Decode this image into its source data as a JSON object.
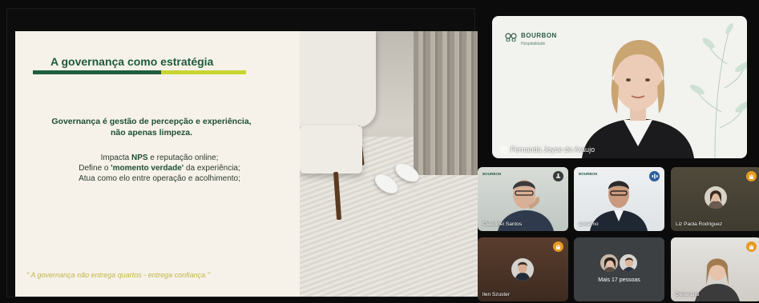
{
  "slide": {
    "title": "A governança como estratégia",
    "heading_line1": "Governança é gestão de percepção e experiência,",
    "heading_line2": "não apenas limpeza.",
    "point1_prefix": "Impacta ",
    "point1_bold": "NPS",
    "point1_suffix": " e reputação online;",
    "point2_prefix": "Define o ",
    "point2_bold": "'momento verdade'",
    "point2_suffix": " da experiência;",
    "point3": "Atua como elo entre operação e acolhimento;",
    "quote": "\" A governança não entrega quartos - entrega confiança.\"",
    "colors": {
      "primary_green": "#1e5e3c",
      "accent_lime": "#c9d531",
      "background": "#f6f2e9"
    }
  },
  "speaker": {
    "name": "Fernanda Joyce de Araujo",
    "brand": "BOURBON",
    "brand_sub": "Hospitalidade"
  },
  "participants": [
    {
      "name": "Claudinei Santos",
      "badge": "pin-icon"
    },
    {
      "name": "ancelmo",
      "badge": "audio-icon"
    },
    {
      "name": "Liz Paola Rodriguez",
      "badge": "raised-hand-icon"
    },
    {
      "name": "llen Szuster",
      "badge": "raised-hand-icon"
    },
    {
      "name": "Mais 17 pessoas"
    },
    {
      "name": "Deise Lira",
      "badge": "raised-hand-icon"
    }
  ]
}
